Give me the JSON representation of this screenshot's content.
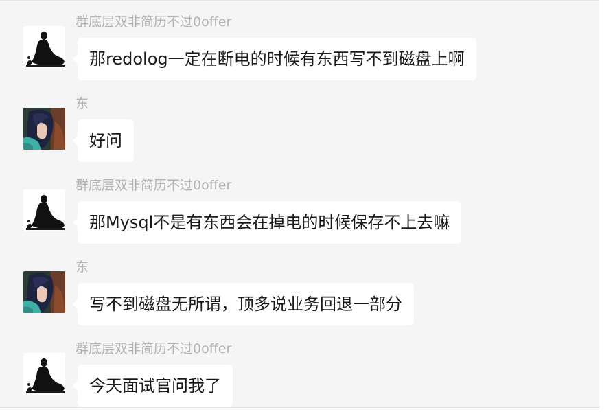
{
  "chat": {
    "messages": [
      {
        "sender": "群底层双非简历不过0offer",
        "text": "那redolog一定在断电的时候有东西写不到磁盘上啊",
        "avatar": "monk-silhouette-avatar"
      },
      {
        "sender": "东",
        "text": "好问",
        "avatar": "anime-girl-avatar"
      },
      {
        "sender": "群底层双非简历不过0offer",
        "text": "那Mysql不是有东西会在掉电的时候保存不上去嘛",
        "avatar": "monk-silhouette-avatar"
      },
      {
        "sender": "东",
        "text": "写不到磁盘无所谓，顶多说业务回退一部分",
        "avatar": "anime-girl-avatar"
      },
      {
        "sender": "群底层双非简历不过0offer",
        "text": "今天面试官问我了",
        "avatar": "monk-silhouette-avatar"
      }
    ]
  },
  "colors": {
    "background": "#f5f5f5",
    "bubble": "#ffffff",
    "sender_text": "#b3b3b3",
    "message_text": "#1a1a1a"
  }
}
